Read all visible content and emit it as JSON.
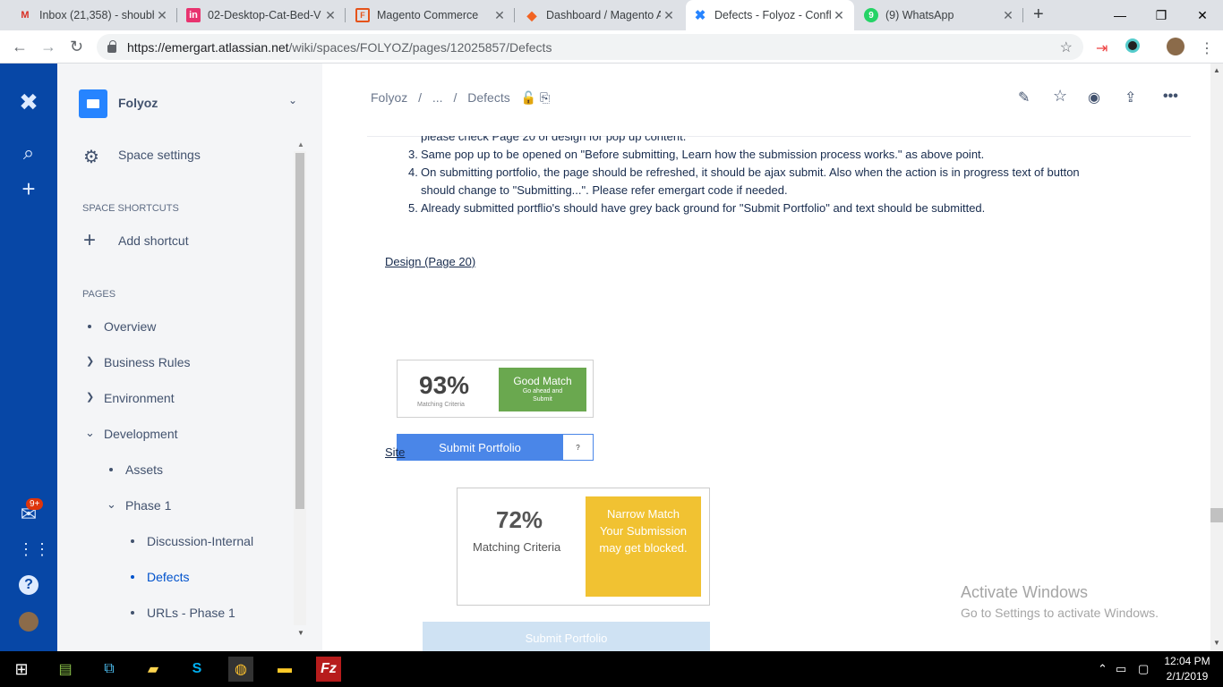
{
  "browser": {
    "tabs": [
      {
        "title": "Inbox (21,358) - shoubh",
        "icon": "gmail-icon",
        "active": false
      },
      {
        "title": "02-Desktop-Cat-Bed-V",
        "icon": "invision-icon",
        "active": false
      },
      {
        "title": "Magento Commerce",
        "icon": "magento-commerce-icon",
        "active": false
      },
      {
        "title": "Dashboard / Magento A",
        "icon": "magento-icon",
        "active": false
      },
      {
        "title": "Defects - Folyoz - Confl",
        "icon": "confluence-icon",
        "active": true
      },
      {
        "title": "(9) WhatsApp",
        "icon": "whatsapp-icon",
        "active": false
      }
    ],
    "url_host": "https://emergart.atlassian.net",
    "url_path": "/wiki/spaces/FOLYOZ/pages/12025857/Defects"
  },
  "sidebar": {
    "space_name": "Folyoz",
    "space_settings": "Space settings",
    "shortcuts_heading": "SPACE SHORTCUTS",
    "add_shortcut": "Add shortcut",
    "pages_heading": "PAGES",
    "pages": [
      {
        "label": "Overview",
        "marker": "bullet",
        "indent": 0
      },
      {
        "label": "Business Rules",
        "marker": "chevron-right",
        "indent": 0
      },
      {
        "label": "Environment",
        "marker": "chevron-right",
        "indent": 0
      },
      {
        "label": "Development",
        "marker": "chevron-down",
        "indent": 0
      },
      {
        "label": "Assets",
        "marker": "bullet",
        "indent": 1
      },
      {
        "label": "Phase 1",
        "marker": "chevron-down",
        "indent": 1
      },
      {
        "label": "Discussion-Internal",
        "marker": "bullet",
        "indent": 2
      },
      {
        "label": "Defects",
        "marker": "bullet",
        "indent": 2,
        "selected": true
      },
      {
        "label": "URLs - Phase 1",
        "marker": "bullet",
        "indent": 2
      }
    ]
  },
  "leftnav": {
    "notifications_badge": "9+"
  },
  "page": {
    "breadcrumb": [
      "Folyoz",
      "...",
      "Defects"
    ],
    "list_items": [
      {
        "num": "",
        "text": "please check Page 20 of design for pop up content."
      },
      {
        "num": "3.",
        "text": "Same pop up to be opened on \"Before submitting, Learn how the submission process works.\" as above point."
      },
      {
        "num": "4.",
        "text": "On submitting portfolio, the page should be refreshed, it should be ajax submit. Also when the action is in progress text of button"
      },
      {
        "num": "",
        "text": "should change to \"Submitting...\". Please refer emergart code if needed."
      },
      {
        "num": "5.",
        "text": "Already submitted portflio's should have grey back ground for \"Submit Portfolio\" and text should be submitted."
      }
    ],
    "design_link": "Design (Page 20)",
    "design_card": {
      "percent": "93%",
      "criteria": "Matching Criteria",
      "match_title": "Good Match",
      "match_sub": "Go ahead and Submit",
      "submit": "Submit Portfolio",
      "help": "?"
    },
    "site_link": "Site",
    "site_card": {
      "percent": "72%",
      "criteria": "Matching Criteria",
      "match_text": "Narrow Match Your Submission may get blocked.",
      "submit": "Submit Portfolio"
    }
  },
  "watermark": {
    "line1": "Activate Windows",
    "line2": "Go to Settings to activate Windows."
  },
  "taskbar": {
    "time": "12:04 PM",
    "date": "2/1/2019"
  },
  "colors": {
    "confluence_nav": "#0747A6",
    "good_match": "#6aa84f",
    "narrow_match": "#f1c232",
    "submit_blue": "#4a86e8"
  }
}
